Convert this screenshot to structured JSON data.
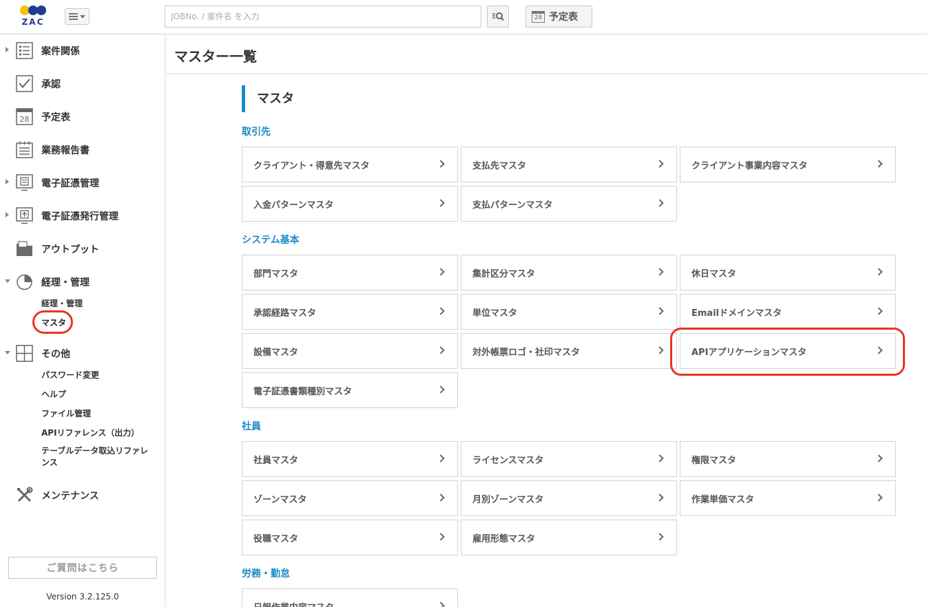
{
  "header": {
    "logo_text": "ZAC",
    "search_placeholder": "JOBNo. / 案件名 を入力",
    "schedule_button": "予定表",
    "calendar_day": "28"
  },
  "sidebar": {
    "items": [
      {
        "label": "案件関係",
        "icon": "list-icon",
        "arrow": "right"
      },
      {
        "label": "承認",
        "icon": "checkbox-icon",
        "arrow": "none"
      },
      {
        "label": "予定表",
        "icon": "calendar-icon",
        "arrow": "none",
        "day": "28"
      },
      {
        "label": "業務報告書",
        "icon": "report-icon",
        "arrow": "none"
      },
      {
        "label": "電子証憑管理",
        "icon": "document-monitor-icon",
        "arrow": "right"
      },
      {
        "label": "電子証憑発行管理",
        "icon": "upload-monitor-icon",
        "arrow": "right"
      },
      {
        "label": "アウトプット",
        "icon": "folder-icon",
        "arrow": "none"
      },
      {
        "label": "経理・管理",
        "icon": "pie-chart-icon",
        "arrow": "down"
      },
      {
        "label": "その他",
        "icon": "plus-box-icon",
        "arrow": "down"
      },
      {
        "label": "メンテナンス",
        "icon": "tools-icon",
        "arrow": "none"
      }
    ],
    "accounting_sub": [
      "経理・管理",
      "マスタ"
    ],
    "other_sub": [
      "パスワード変更",
      "ヘルプ",
      "ファイル管理",
      "APIリファレンス（出力）",
      "テーブルデータ取込リファレンス"
    ],
    "question_button": "ご質問はこちら",
    "version": "Version 3.2.125.0"
  },
  "main": {
    "page_title": "マスター一覧",
    "section_title": "マスタ",
    "groups": [
      {
        "title": "取引先",
        "cards": [
          "クライアント・得意先マスタ",
          "支払先マスタ",
          "クライアント事業内容マスタ",
          "入金パターンマスタ",
          "支払パターンマスタ"
        ]
      },
      {
        "title": "システム基本",
        "cards": [
          "部門マスタ",
          "集計区分マスタ",
          "休日マスタ",
          "承認経路マスタ",
          "単位マスタ",
          "Emailドメインマスタ",
          "設備マスタ",
          "対外帳票ロゴ・社印マスタ",
          "APIアプリケーションマスタ",
          "電子証憑書類種別マスタ"
        ]
      },
      {
        "title": "社員",
        "cards": [
          "社員マスタ",
          "ライセンスマスタ",
          "権限マスタ",
          "ゾーンマスタ",
          "月別ゾーンマスタ",
          "作業単価マスタ",
          "役職マスタ",
          "雇用形態マスタ"
        ]
      },
      {
        "title": "労務・勤怠",
        "cards": [
          "日報作業内容マスタ"
        ]
      }
    ]
  },
  "colors": {
    "accent": "#1a8ac6",
    "highlight": "#e8341c"
  }
}
